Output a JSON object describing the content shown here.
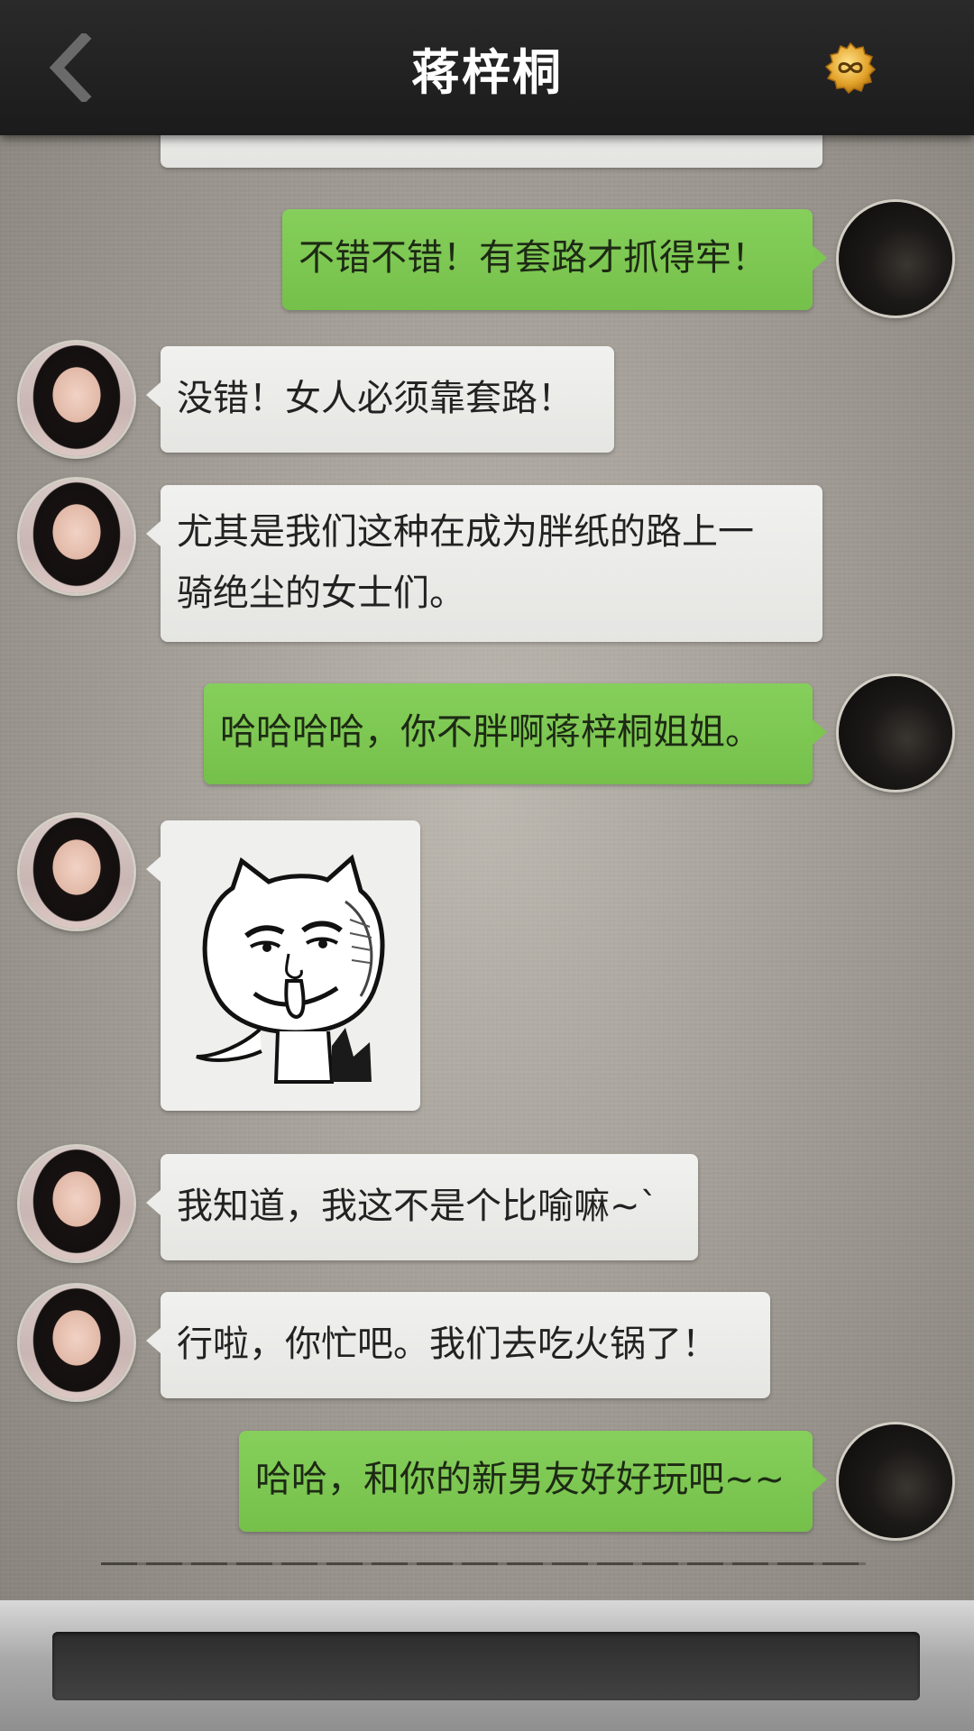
{
  "header": {
    "title": "蒋梓桐",
    "back_icon": "chevron-left-icon",
    "badge_icon": "infinity-coin-icon",
    "badge_color": "#e2a22a"
  },
  "colors": {
    "incoming_bubble": "#ececea",
    "outgoing_bubble": "#7cc651",
    "header_bg": "#1f1f1f"
  },
  "messages": [
    {
      "side": "out",
      "text": "不错不错！有套路才抓得牢！"
    },
    {
      "side": "in",
      "text": "没错！女人必须靠套路！"
    },
    {
      "side": "in",
      "text_line1": "尤其是我们这种在成为胖纸的路上一",
      "text_line2": "骑绝尘的女士们。"
    },
    {
      "side": "out",
      "text": "哈哈哈哈，你不胖啊蒋梓桐姐姐。"
    },
    {
      "side": "in",
      "type": "sticker",
      "sticker": "smirking-cat-devil-meme"
    },
    {
      "side": "in",
      "text": "我知道，我这不是个比喻嘛~`"
    },
    {
      "side": "in",
      "text": "行啦，你忙吧。我们去吃火锅了！"
    },
    {
      "side": "out",
      "text": "哈哈，和你的新男友好好玩吧~~"
    }
  ],
  "input": {
    "value": "",
    "placeholder": ""
  }
}
